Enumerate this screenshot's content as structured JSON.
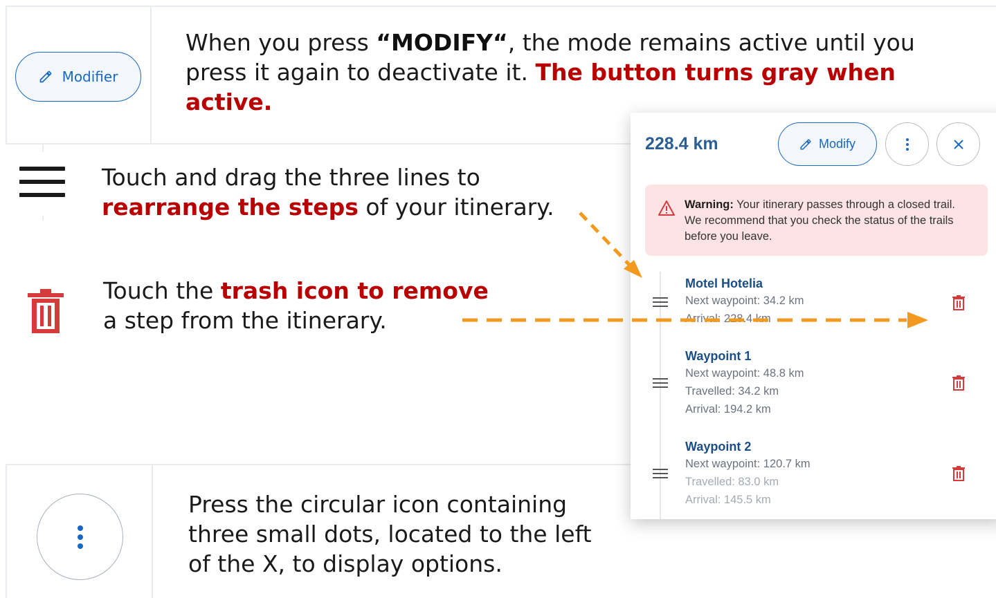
{
  "section1": {
    "button_label": "Modifier",
    "text_before": "When you press ",
    "text_modify": "“MODIFY“",
    "text_middle": ", the mode remains active until you press it again to deactivate it. ",
    "text_bold": "The button turns gray when active."
  },
  "section2": {
    "text_before": "Touch and drag the three lines to ",
    "text_bold": "rearrange the steps",
    "text_after": " of your itinerary."
  },
  "section3": {
    "text_before": "Touch the ",
    "text_bold": "trash icon to remove",
    "text_after": " a step from the itinerary."
  },
  "section4": {
    "text": "Press the circular icon containing three small dots, located to the left of the X, to display options."
  },
  "panel": {
    "distance": "228.4 km",
    "modify_label": "Modify",
    "warning": {
      "label": "Warning:",
      "text": " Your itinerary passes through a closed trail. We recommend that you check the status of the trails before you leave."
    },
    "waypoints": [
      {
        "title": "Motel Hotelia",
        "lines": [
          "Next waypoint: 34.2 km",
          "Arrival: 228.4 km"
        ]
      },
      {
        "title": "Waypoint 1",
        "lines": [
          "Next waypoint: 48.8 km",
          "Travelled: 34.2 km",
          "Arrival: 194.2 km"
        ]
      },
      {
        "title": "Waypoint 2",
        "lines": [
          "Next waypoint: 120.7 km",
          "Travelled: 83.0 km",
          "Arrival: 145.5 km"
        ]
      }
    ]
  },
  "colors": {
    "accent": "#1769c2",
    "trash_red": "#d63b3b",
    "arrow_orange": "#f29a1f",
    "warning_bg": "#fde3e3",
    "highlight_red": "#b80000"
  },
  "icons": {
    "pencil": "pencil-icon",
    "hamburger": "drag-handle-icon",
    "trash": "trash-icon",
    "more": "more-vertical-icon",
    "close": "close-icon",
    "warning": "warning-triangle-icon"
  }
}
